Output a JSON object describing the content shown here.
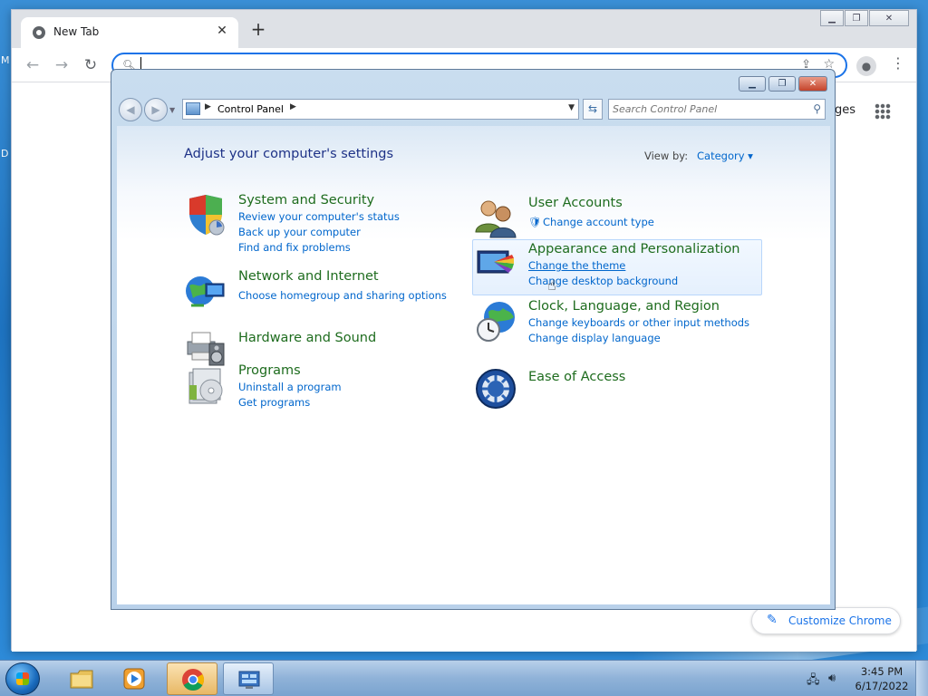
{
  "desktop": {
    "label_m": "M",
    "label_d": "D"
  },
  "chrome": {
    "tab_title": "New Tab",
    "new_tab_glyph": "+",
    "tab_close_glyph": "✕",
    "omnibox_value": "",
    "images_link": "ges",
    "customize_label": "Customize Chrome"
  },
  "control_panel": {
    "breadcrumb": "Control Panel",
    "search_placeholder": "Search Control Panel",
    "heading": "Adjust your computer's settings",
    "view_by_label": "View by:",
    "view_by_value": "Category",
    "categories": [
      {
        "title": "System and Security",
        "links": [
          "Review your computer's status",
          "Back up your computer",
          "Find and fix problems"
        ]
      },
      {
        "title": "Network and Internet",
        "links": [
          "Choose homegroup and sharing options"
        ]
      },
      {
        "title": "Hardware and Sound",
        "links": []
      },
      {
        "title": "Programs",
        "links": [
          "Uninstall a program",
          "Get programs"
        ]
      },
      {
        "title": "User Accounts",
        "links": [
          "Change account type"
        ]
      },
      {
        "title": "Appearance and Personalization",
        "links": [
          "Change the theme",
          "Change desktop background"
        ]
      },
      {
        "title": "Clock, Language, and Region",
        "links": [
          "Change keyboards or other input methods",
          "Change display language"
        ]
      },
      {
        "title": "Ease of Access",
        "links": []
      }
    ]
  },
  "taskbar": {
    "time": "3:45 PM",
    "date": "6/17/2022"
  },
  "colors": {
    "category_title": "#1e6c1e",
    "link": "#0066cc",
    "heading": "#1e3287",
    "chrome_accent": "#1a73e8"
  }
}
